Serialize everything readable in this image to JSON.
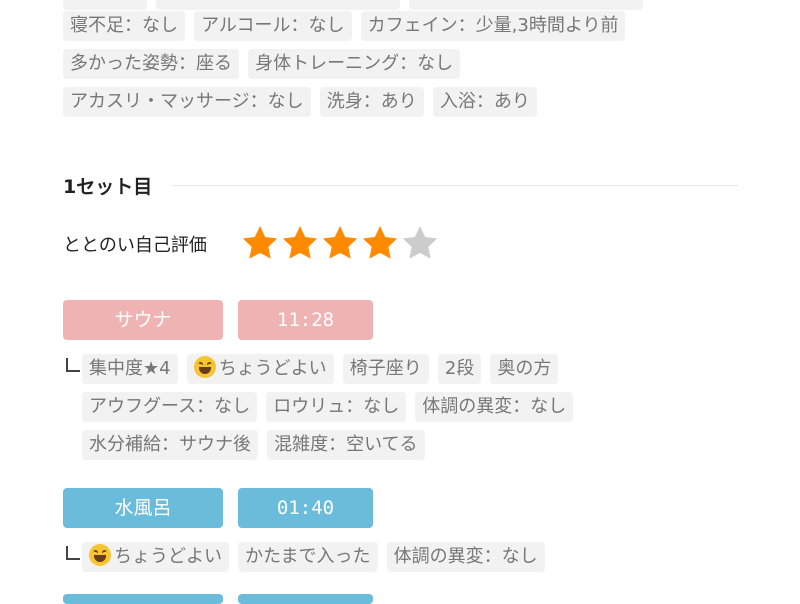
{
  "conditions": {
    "row1": [
      "寝不足：なし",
      "アルコール：なし",
      "カフェイン：少量,3時間より前"
    ],
    "row2": [
      "多かった姿勢：座る",
      "身体トレーニング：なし"
    ],
    "row3": [
      "アカスリ・マッサージ：なし",
      "洗身：あり",
      "入浴：あり"
    ]
  },
  "set": {
    "title": "1セット目",
    "rating_label": "ととのい自己評価",
    "rating": 4,
    "rating_max": 5
  },
  "sauna": {
    "label": "サウナ",
    "time": "11:28",
    "tags_row1": [
      "集中度★4",
      "ちょうどよい",
      "椅子座り",
      "2段",
      "奥の方"
    ],
    "tags_row2": [
      "アウフグース：なし",
      "ロウリュ：なし",
      "体調の異変：なし"
    ],
    "tags_row3": [
      "水分補給：サウナ後",
      "混雑度：空いてる"
    ]
  },
  "water": {
    "label": "水風呂",
    "time": "01:40",
    "tags_row1": [
      "ちょうどよい",
      "かたまで入った",
      "体調の異変：なし"
    ]
  },
  "colors": {
    "star_on": "#ff8a00",
    "star_off": "#cccccc",
    "sauna": "#efb3b3",
    "water": "#6bbcdb"
  }
}
